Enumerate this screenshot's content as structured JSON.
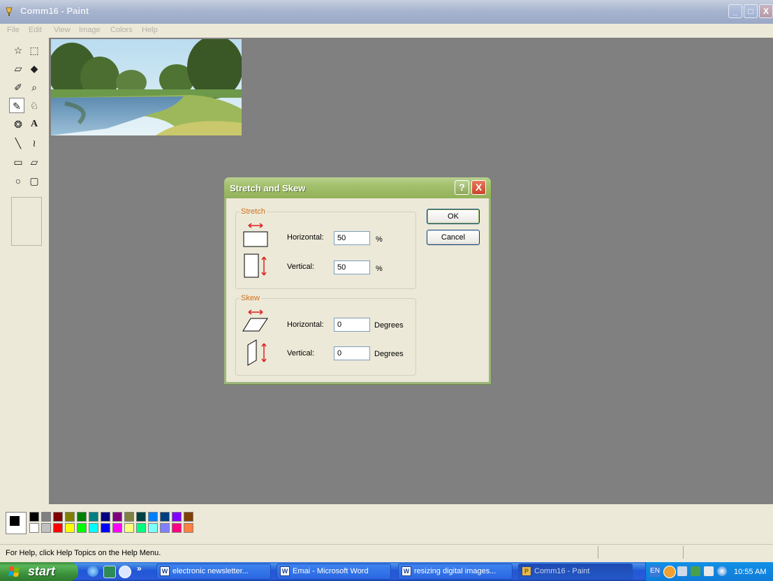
{
  "window": {
    "title": "Comm16  - Paint",
    "min_label": "_",
    "max_label": "□",
    "close_label": "X"
  },
  "menu": [
    "File",
    "Edit",
    "View",
    "Image",
    "Colors",
    "Help"
  ],
  "toolbox": {
    "tools": [
      {
        "name": "free-form-select",
        "glyph": "☆"
      },
      {
        "name": "select",
        "glyph": "⬚"
      },
      {
        "name": "eraser",
        "glyph": "▱"
      },
      {
        "name": "fill",
        "glyph": "◆"
      },
      {
        "name": "pick-color",
        "glyph": "✐"
      },
      {
        "name": "magnifier",
        "glyph": "⌕"
      },
      {
        "name": "pencil",
        "glyph": "✎"
      },
      {
        "name": "brush",
        "glyph": "♘"
      },
      {
        "name": "airbrush",
        "glyph": "❂"
      },
      {
        "name": "text",
        "glyph": "A"
      },
      {
        "name": "line",
        "glyph": "╲"
      },
      {
        "name": "curve",
        "glyph": "≀"
      },
      {
        "name": "rectangle",
        "glyph": "▭"
      },
      {
        "name": "polygon",
        "glyph": "▱"
      },
      {
        "name": "ellipse",
        "glyph": "○"
      },
      {
        "name": "rounded-rectangle",
        "glyph": "▢"
      }
    ],
    "selected_tool": "pencil"
  },
  "palette": {
    "foreground": "#000000",
    "background": "#ffffff",
    "row1": [
      "#000000",
      "#808080",
      "#800000",
      "#808000",
      "#008000",
      "#008080",
      "#000080",
      "#800080",
      "#808040",
      "#004040",
      "#0080ff",
      "#004080",
      "#8000ff",
      "#804000"
    ],
    "row2": [
      "#ffffff",
      "#c0c0c0",
      "#ff0000",
      "#ffff00",
      "#00ff00",
      "#00ffff",
      "#0000ff",
      "#ff00ff",
      "#ffff80",
      "#00ff80",
      "#80ffff",
      "#8080ff",
      "#ff0080",
      "#ff8040"
    ]
  },
  "status": {
    "help_text": "For Help, click Help Topics on the Help Menu."
  },
  "dialog": {
    "title": "Stretch and Skew",
    "help_label": "?",
    "close_label": "X",
    "stretch": {
      "group_label": "Stretch",
      "horizontal_label": "Horizontal:",
      "horizontal_value": "50",
      "horizontal_unit": "%",
      "vertical_label": "Vertical:",
      "vertical_value": "50",
      "vertical_unit": "%"
    },
    "skew": {
      "group_label": "Skew",
      "horizontal_label": "Horizontal:",
      "horizontal_value": "0",
      "horizontal_unit": "Degrees",
      "vertical_label": "Vertical:",
      "vertical_value": "0",
      "vertical_unit": "Degrees"
    },
    "ok_label": "OK",
    "cancel_label": "Cancel"
  },
  "taskbar": {
    "start_label": "start",
    "quicklaunch_more": "»",
    "tasks": [
      {
        "label": "electronic newsletter...",
        "icon": "W",
        "active": false
      },
      {
        "label": "Emai - Microsoft Word",
        "icon": "W",
        "active": false
      },
      {
        "label": "resizing digital images...",
        "icon": "W",
        "active": false
      },
      {
        "label": "Comm16  - Paint",
        "icon": "P",
        "active": true
      }
    ],
    "language": "EN",
    "clock": "10:55 AM"
  }
}
